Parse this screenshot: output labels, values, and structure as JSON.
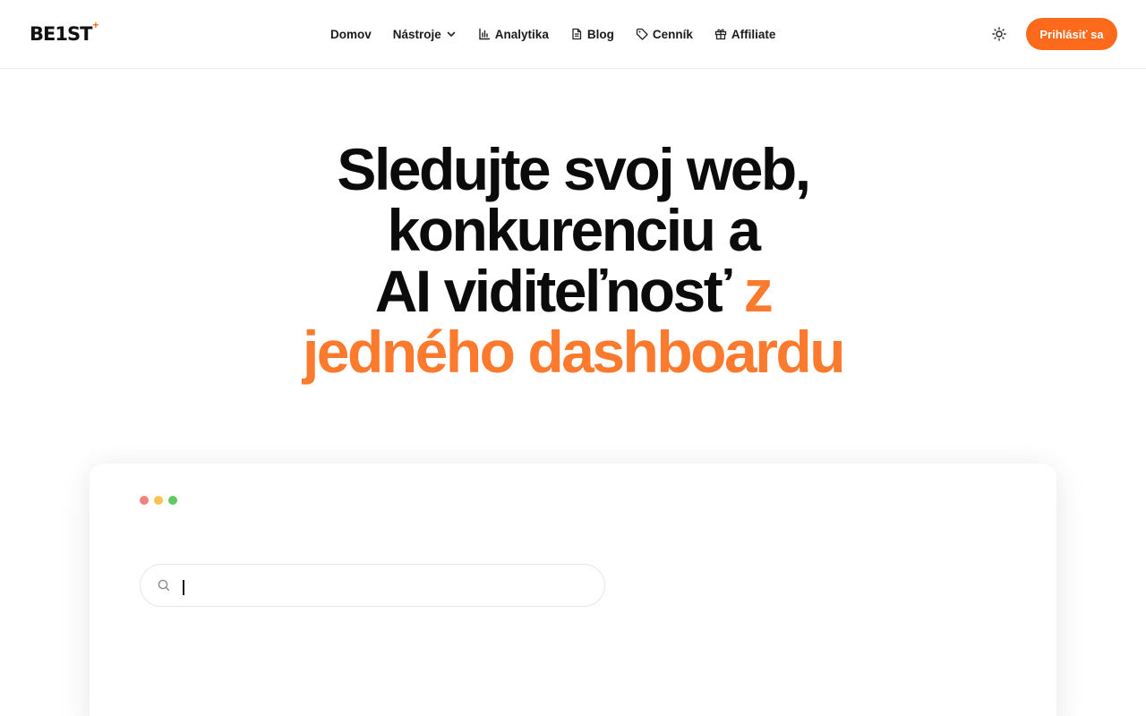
{
  "header": {
    "logo": {
      "text": "BE1ST",
      "star": "+"
    },
    "nav": [
      {
        "label": "Domov",
        "icon": ""
      },
      {
        "label": "Nástroje",
        "icon": "chevron-down-icon"
      },
      {
        "label": "Analytika",
        "icon": "bar-chart-icon"
      },
      {
        "label": "Blog",
        "icon": "document-icon"
      },
      {
        "label": "Cenník",
        "icon": "tag-icon"
      },
      {
        "label": "Affiliate",
        "icon": "gift-icon"
      }
    ],
    "theme_toggle_icon": "sun-icon",
    "login_label": "Prihlásiť sa"
  },
  "hero": {
    "line1": "Sledujte svoj web,",
    "line2": "konkurenciu a",
    "line3_main": "AI viditeľnosť",
    "line3_accent": "z",
    "line4_accent": "jedného dashboardu"
  },
  "card": {
    "window_dots": [
      "red",
      "yellow",
      "green"
    ],
    "search": {
      "value": "",
      "placeholder": "",
      "icon": "search-icon"
    }
  },
  "colors": {
    "accent": "#fe6a1c",
    "accent_text": "#fb7a2e",
    "dot_red": "#f0837a",
    "dot_yellow": "#f5c451",
    "dot_green": "#5fc964"
  }
}
